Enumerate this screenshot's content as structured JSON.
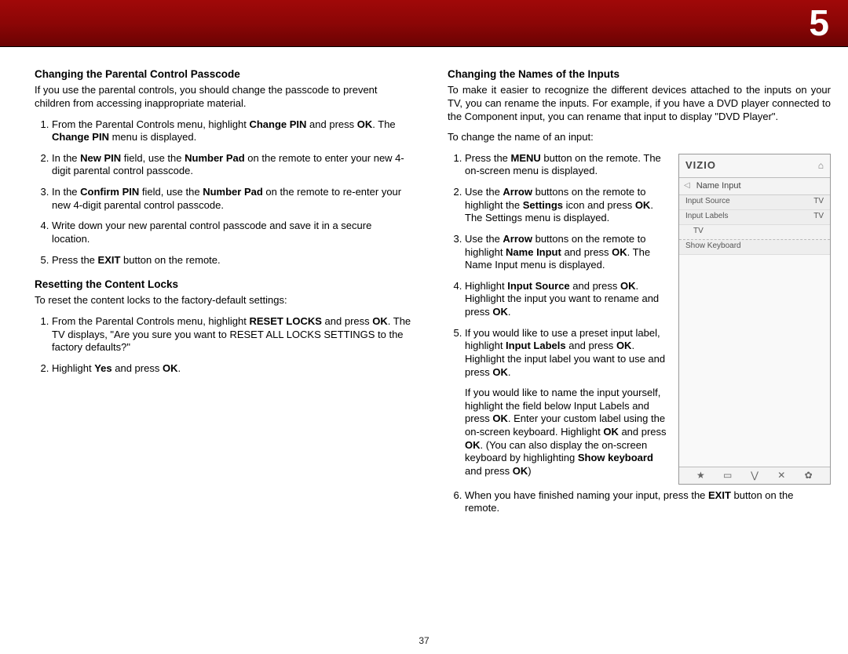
{
  "chapter_number": "5",
  "page_number": "37",
  "left": {
    "h1": "Changing the Parental Control Passcode",
    "p1": "If you use the parental controls, you should change the passcode to prevent children from accessing inappropriate material.",
    "s1_a": "From the Parental Controls menu, highlight ",
    "s1_b": "Change PIN",
    "s1_c": " and press ",
    "s1_d": "OK",
    "s1_e": ". The ",
    "s1_f": "Change PIN",
    "s1_g": " menu is displayed.",
    "s2_a": "In the ",
    "s2_b": "New PIN",
    "s2_c": " field, use the ",
    "s2_d": "Number Pad",
    "s2_e": " on the remote to enter your new 4-digit parental control passcode.",
    "s3_a": "In the ",
    "s3_b": "Confirm PIN",
    "s3_c": " field, use the ",
    "s3_d": "Number Pad",
    "s3_e": " on the remote to re-enter your new 4-digit parental control passcode.",
    "s4": "Write down your new parental control passcode and save it in a secure location.",
    "s5_a": "Press the ",
    "s5_b": "EXIT",
    "s5_c": " button on the remote.",
    "h2": "Resetting the Content Locks",
    "p2": "To reset the content locks to the factory-default settings:",
    "r1_a": "From the Parental Controls menu, highlight ",
    "r1_b": "RESET LOCKS",
    "r1_c": " and press ",
    "r1_d": "OK",
    "r1_e": ". The TV displays, \"Are you sure you want to RESET ALL LOCKS SETTINGS to the factory defaults?\"",
    "r2_a": "Highlight ",
    "r2_b": "Yes",
    "r2_c": " and press ",
    "r2_d": "OK",
    "r2_e": "."
  },
  "right": {
    "h1": "Changing the Names of the Inputs",
    "p1": "To make it easier to recognize the different devices attached to the inputs on your TV, you can rename the inputs. For example, if you have a DVD player connected to the Component input, you can rename that input to display \"DVD Player\".",
    "p2": "To change the name of an input:",
    "s1_a": "Press the ",
    "s1_b": "MENU",
    "s1_c": " button on the remote. The on-screen menu is displayed.",
    "s2_a": "Use the ",
    "s2_b": "Arrow",
    "s2_c": " buttons on the remote to highlight the ",
    "s2_d": "Settings",
    "s2_e": " icon and press ",
    "s2_f": "OK",
    "s2_g": ". The Settings menu is displayed.",
    "s3_a": "Use the ",
    "s3_b": "Arrow",
    "s3_c": " buttons on the remote to highlight ",
    "s3_d": "Name Input",
    "s3_e": " and press ",
    "s3_f": "OK",
    "s3_g": ". The Name Input menu is displayed.",
    "s4_a": "Highlight ",
    "s4_b": "Input Source",
    "s4_c": " and press ",
    "s4_d": "OK",
    "s4_e": ". Highlight the input you want to rename and press ",
    "s4_f": "OK",
    "s4_g": ".",
    "s5_a": "If you would like to use a preset input label, highlight ",
    "s5_b": "Input Labels",
    "s5_c": " and press ",
    "s5_d": "OK",
    "s5_e": ". Highlight the input label you want to use and press ",
    "s5_f": "OK",
    "s5_g": ".",
    "s5x_a": "If you would like to name the input yourself, highlight the field below Input Labels and press ",
    "s5x_b": "OK",
    "s5x_c": ". Enter your custom label using the on-screen keyboard. Highlight ",
    "s5x_d": "OK",
    "s5x_e": " and press ",
    "s5x_f": "OK",
    "s5x_g": ". (You can also display the on-screen keyboard by highlighting ",
    "s5x_h": "Show keyboard",
    "s5x_i": " and press ",
    "s5x_j": "OK",
    "s5x_k": ")",
    "s6_a": "When you have finished naming your input, press the ",
    "s6_b": "EXIT",
    "s6_c": " button on the remote."
  },
  "menu": {
    "logo": "VIZIO",
    "home": "⌂",
    "back": "◁",
    "title": "Name Input",
    "row1_l": "Input Source",
    "row1_r": "TV",
    "row2_l": "Input Labels",
    "row2_r": "TV",
    "row3": "TV",
    "row4": "Show Keyboard",
    "f1": "★",
    "f2": "▭",
    "f3": "⋁",
    "f4": "✕",
    "f5": "✿"
  }
}
